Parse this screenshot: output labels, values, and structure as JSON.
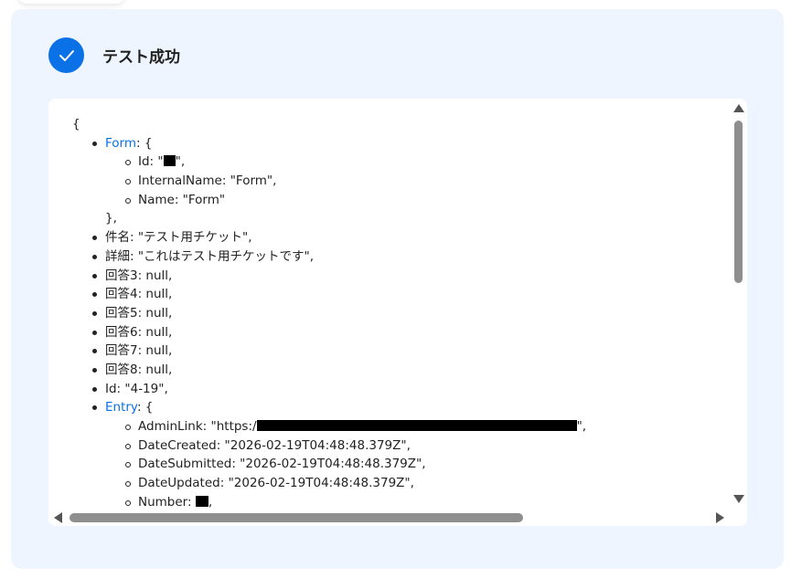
{
  "status": {
    "title": "テスト成功",
    "icon": "check-icon",
    "accent_color": "#0a71e6"
  },
  "output": {
    "open_brace": "{",
    "form": {
      "key": "Form",
      "open": ": {",
      "id_label": "Id: \"",
      "id_close": "\",",
      "internal_name": "InternalName: \"Form\",",
      "name": "Name: \"Form\"",
      "close": "},"
    },
    "subject": "件名: \"テスト用チケット\",",
    "detail": "詳細: \"これはテスト用チケットです\",",
    "answer3": "回答3: null,",
    "answer4": "回答4: null,",
    "answer5": "回答5: null,",
    "answer6": "回答6: null,",
    "answer7": "回答7: null,",
    "answer8": "回答8: null,",
    "id": "Id: \"4-19\",",
    "entry": {
      "key": "Entry",
      "open": ": {",
      "admin_link_label": "AdminLink: \"https:/",
      "admin_link_close": "\",",
      "date_created": "DateCreated: \"2026-02-19T04:48:48.379Z\",",
      "date_submitted": "DateSubmitted: \"2026-02-19T04:48:48.379Z\",",
      "date_updated": "DateUpdated: \"2026-02-19T04:48:48.379Z\",",
      "number_label": "Number: ",
      "number_close": ","
    }
  }
}
